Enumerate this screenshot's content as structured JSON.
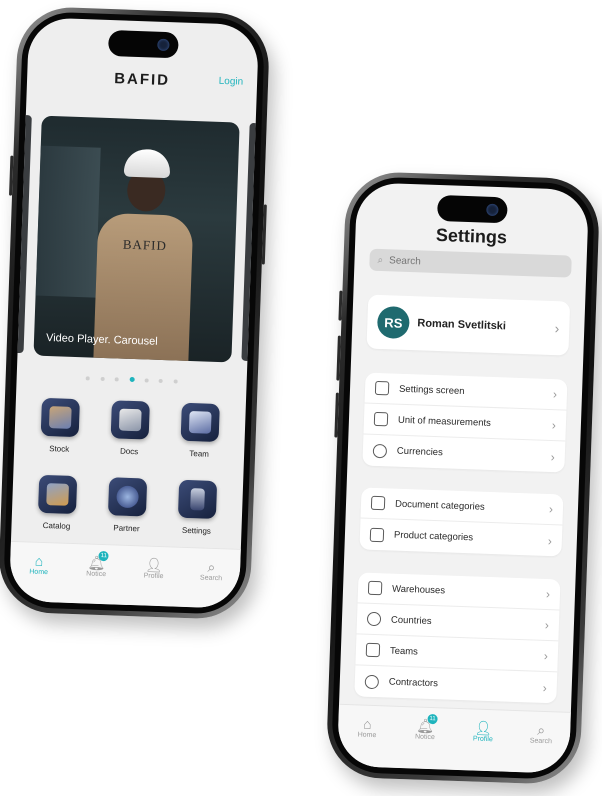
{
  "left_phone": {
    "logo": "BAFID",
    "login_label": "Login",
    "carousel": {
      "caption": "Video Player. Carousel",
      "brand_text": "BAFID",
      "dot_count": 7,
      "active_dot_index": 4
    },
    "tiles": [
      {
        "label": "Stock",
        "icon": "stock-icon"
      },
      {
        "label": "Docs",
        "icon": "docs-icon"
      },
      {
        "label": "Team",
        "icon": "team-icon"
      },
      {
        "label": "Catalog",
        "icon": "catalog-icon"
      },
      {
        "label": "Partner",
        "icon": "partner-icon"
      },
      {
        "label": "Settings",
        "icon": "settings-icon"
      }
    ],
    "tabbar": [
      {
        "label": "Home",
        "icon": "home-icon",
        "active": true
      },
      {
        "label": "Notice",
        "icon": "bell-icon",
        "badge": "11"
      },
      {
        "label": "Profile",
        "icon": "person-icon"
      },
      {
        "label": "Search",
        "icon": "search-icon"
      }
    ]
  },
  "right_phone": {
    "title": "Settings",
    "search_placeholder": "Search",
    "profile": {
      "initials": "RS",
      "name": "Roman Svetlitski"
    },
    "groups": [
      {
        "items": [
          {
            "label": "Settings screen",
            "icon": "phone-gear-icon"
          },
          {
            "label": "Unit of measurements",
            "icon": "ruler-icon"
          },
          {
            "label": "Currencies",
            "icon": "currency-icon"
          }
        ]
      },
      {
        "items": [
          {
            "label": "Document categories",
            "icon": "document-icon"
          },
          {
            "label": "Product categories",
            "icon": "product-list-icon"
          }
        ]
      },
      {
        "items": [
          {
            "label": "Warehouses",
            "icon": "warehouse-icon"
          },
          {
            "label": "Countries",
            "icon": "globe-icon"
          },
          {
            "label": "Teams",
            "icon": "team-icon"
          },
          {
            "label": "Contractors",
            "icon": "handshake-icon"
          }
        ]
      }
    ],
    "tabbar": [
      {
        "label": "Home",
        "icon": "home-icon"
      },
      {
        "label": "Notice",
        "icon": "bell-icon",
        "badge": "11"
      },
      {
        "label": "Profile",
        "icon": "person-icon",
        "active": true
      },
      {
        "label": "Search",
        "icon": "search-icon"
      }
    ]
  },
  "colors": {
    "accent": "#1fb4bd",
    "avatar": "#1f6a6f",
    "tile": "#26325a"
  }
}
